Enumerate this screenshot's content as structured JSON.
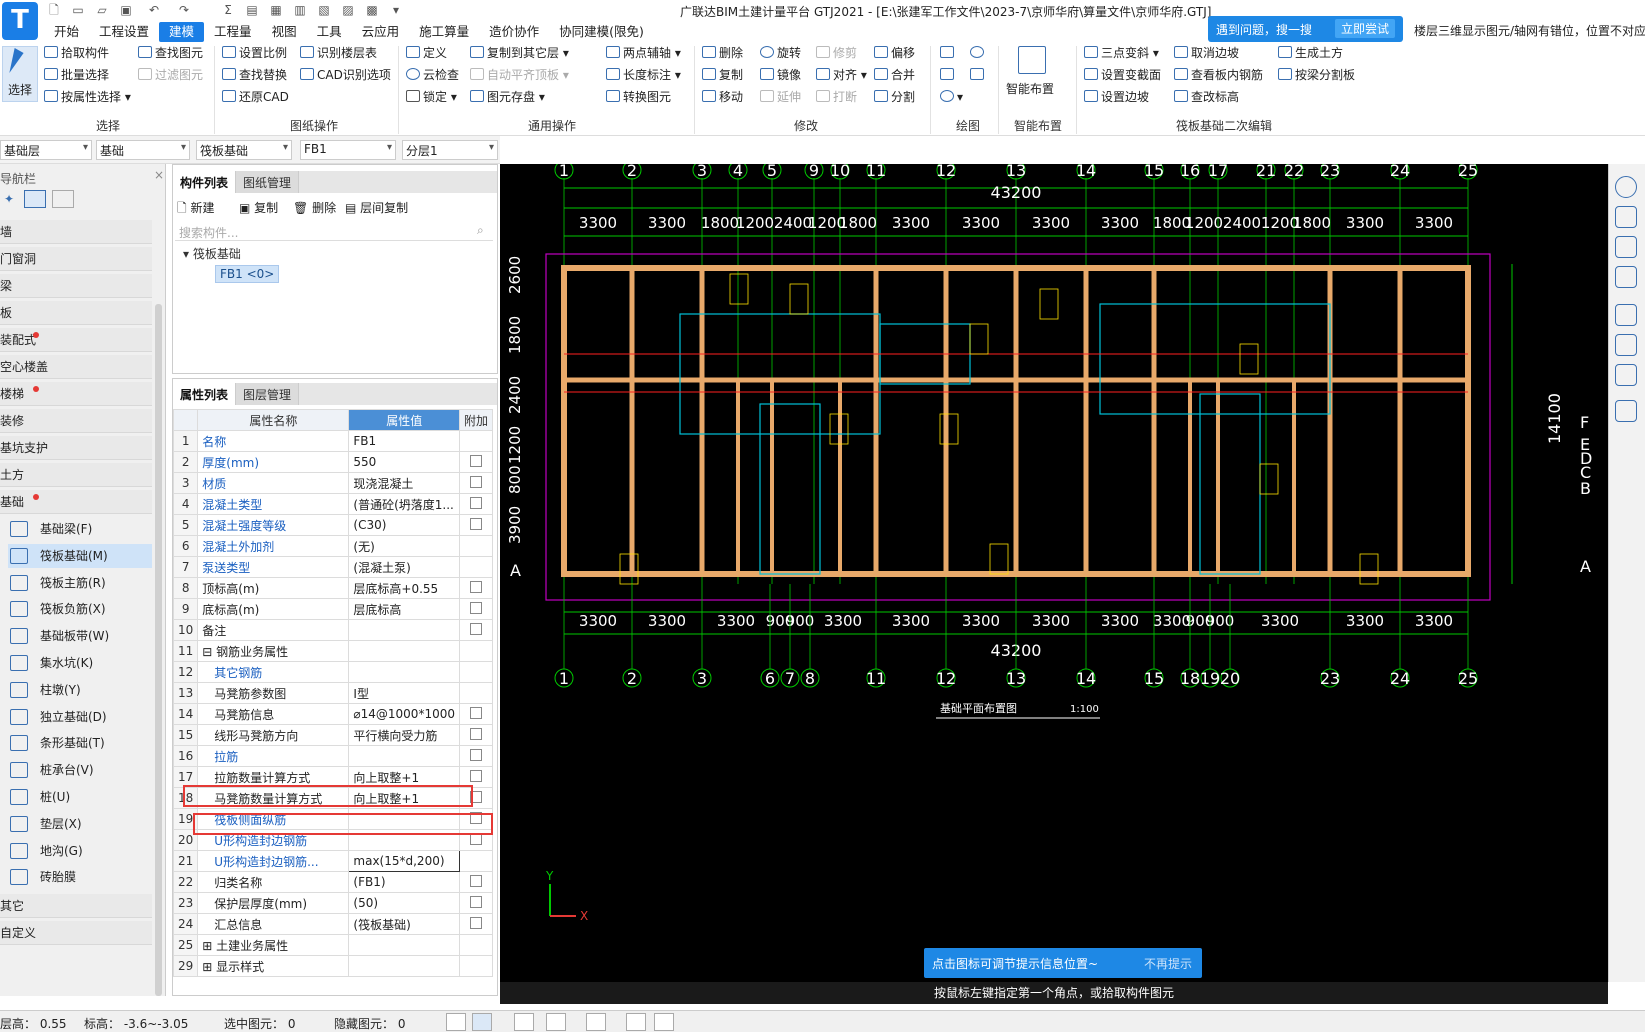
{
  "window": {
    "title": "广联达BIM土建计量平台 GTJ2021 - [E:\\张建军工作文件\\2023-7\\京师华府\\算量文件\\京师华府.GTJ]"
  },
  "menu": [
    "开始",
    "工程设置",
    "建模",
    "工程量",
    "视图",
    "工具",
    "云应用",
    "施工算量",
    "造价协作",
    "协同建模(限免)"
  ],
  "menu_active": "建模",
  "tip": {
    "text": "遇到问题，搜一搜",
    "button": "立即尝试"
  },
  "notice": "楼层三维显示图元/轴网有错位，位置不对应",
  "ribbon": {
    "select": {
      "big": "选择",
      "items": [
        "拾取构件",
        "批量选择",
        "按属性选择",
        "查找图元",
        "过滤图元"
      ],
      "label": "选择"
    },
    "drawing_ops": {
      "items": [
        "设置比例",
        "识别楼层表",
        "查找替换",
        "CAD识别选项",
        "还原CAD"
      ],
      "label": "图纸操作"
    },
    "common_ops": {
      "items": [
        "定义",
        "复制到其它层",
        "两点辅轴",
        "云检查",
        "自动平齐顶板",
        "长度标注",
        "锁定",
        "图元存盘",
        "转换图元"
      ],
      "label": "通用操作"
    },
    "modify": {
      "items": [
        "删除",
        "旋转",
        "修剪",
        "偏移",
        "复制",
        "镜像",
        "对齐",
        "合并",
        "移动",
        "延伸",
        "打断",
        "分割"
      ],
      "label": "修改"
    },
    "draw": {
      "label": "绘图"
    },
    "smart": {
      "big": "智能布置",
      "label": "智能布置"
    },
    "raft_edit": {
      "items": [
        "三点变斜",
        "取消边坡",
        "生成土方",
        "设置变截面",
        "查看板内钢筋",
        "按梁分割板",
        "设置边坡",
        "查改标高"
      ],
      "label": "筏板基础二次编辑"
    }
  },
  "combos": [
    "基础层",
    "基础",
    "筏板基础",
    "FB1",
    "分层1"
  ],
  "nav": {
    "title": "导航栏",
    "categories": [
      "墙",
      "门窗洞",
      "梁",
      "板",
      "装配式",
      "空心楼盖",
      "楼梯",
      "装修",
      "基坑支护",
      "土方",
      "基础"
    ],
    "categories_dot": [
      false,
      false,
      false,
      false,
      true,
      false,
      true,
      false,
      false,
      false,
      true
    ],
    "items": [
      "基础梁(F)",
      "筏板基础(M)",
      "筏板主筋(R)",
      "筏板负筋(X)",
      "基础板带(W)",
      "集水坑(K)",
      "柱墩(Y)",
      "独立基础(D)",
      "条形基础(T)",
      "桩承台(V)",
      "桩(U)",
      "垫层(X)",
      "地沟(G)",
      "砖胎膜"
    ],
    "selected": "筏板基础(M)",
    "bottom": [
      "其它",
      "自定义"
    ]
  },
  "component_list": {
    "tabs": [
      "构件列表",
      "图纸管理"
    ],
    "toolbar": [
      "新建",
      "复制",
      "删除",
      "层间复制"
    ],
    "search_placeholder": "搜索构件...",
    "tree_root": "筏板基础",
    "tree_leaf": "FB1 <0>"
  },
  "property_panel": {
    "tabs": [
      "属性列表",
      "图层管理"
    ],
    "headers": [
      "属性名称",
      "属性值",
      "附加"
    ],
    "rows": [
      {
        "no": "1",
        "name": "名称",
        "value": "FB1",
        "blue": true,
        "chk": false
      },
      {
        "no": "2",
        "name": "厚度(mm)",
        "value": "550",
        "blue": true,
        "chk": true
      },
      {
        "no": "3",
        "name": "材质",
        "value": "现浇混凝土",
        "blue": true,
        "chk": true
      },
      {
        "no": "4",
        "name": "混凝土类型",
        "value": "(普通砼(坍落度1...",
        "blue": true,
        "chk": true
      },
      {
        "no": "5",
        "name": "混凝土强度等级",
        "value": "(C30)",
        "blue": true,
        "chk": true
      },
      {
        "no": "6",
        "name": "混凝土外加剂",
        "value": "(无)",
        "blue": true,
        "chk": false
      },
      {
        "no": "7",
        "name": "泵送类型",
        "value": "(混凝土泵)",
        "blue": true,
        "chk": false
      },
      {
        "no": "8",
        "name": "顶标高(m)",
        "value": "层底标高+0.55",
        "blue": false,
        "chk": true
      },
      {
        "no": "9",
        "name": "底标高(m)",
        "value": "层底标高",
        "blue": false,
        "chk": true
      },
      {
        "no": "10",
        "name": "备注",
        "value": "",
        "blue": false,
        "chk": true
      },
      {
        "no": "11",
        "name": "⊟ 钢筋业务属性",
        "value": "",
        "blue": false,
        "chk": false
      },
      {
        "no": "12",
        "name": "　其它钢筋",
        "value": "",
        "blue": true,
        "chk": false
      },
      {
        "no": "13",
        "name": "　马凳筋参数图",
        "value": "I型",
        "blue": false,
        "chk": false
      },
      {
        "no": "14",
        "name": "　马凳筋信息",
        "value": "⌀14@1000*1000",
        "blue": false,
        "chk": true
      },
      {
        "no": "15",
        "name": "　线形马凳筋方向",
        "value": "平行横向受力筋",
        "blue": false,
        "chk": true
      },
      {
        "no": "16",
        "name": "　拉筋",
        "value": "",
        "blue": true,
        "chk": true
      },
      {
        "no": "17",
        "name": "　拉筋数量计算方式",
        "value": "向上取整+1",
        "blue": false,
        "chk": true
      },
      {
        "no": "18",
        "name": "　马凳筋数量计算方式",
        "value": "向上取整+1",
        "blue": false,
        "chk": true
      },
      {
        "no": "19",
        "name": "　筏板侧面纵筋",
        "value": "",
        "blue": true,
        "chk": true
      },
      {
        "no": "20",
        "name": "　U形构造封边钢筋",
        "value": "",
        "blue": true,
        "chk": true
      },
      {
        "no": "21",
        "name": "　U形构造封边钢筋...",
        "value": "max(15*d,200)",
        "blue": true,
        "chk": false
      },
      {
        "no": "22",
        "name": "　归类名称",
        "value": "(FB1)",
        "blue": false,
        "chk": true
      },
      {
        "no": "23",
        "name": "　保护层厚度(mm)",
        "value": "(50)",
        "blue": false,
        "chk": true
      },
      {
        "no": "24",
        "name": "　汇总信息",
        "value": "(筏板基础)",
        "blue": false,
        "chk": true
      },
      {
        "no": "25",
        "name": "⊞ 土建业务属性",
        "value": "",
        "blue": false,
        "chk": false
      },
      {
        "no": "29",
        "name": "⊞ 显示样式",
        "value": "",
        "blue": false,
        "chk": false
      }
    ]
  },
  "cad": {
    "top_axes": [
      "1",
      "2",
      "3",
      "4",
      "5",
      "9",
      "10",
      "11",
      "12",
      "13",
      "14",
      "15",
      "16",
      "17",
      "21",
      "22",
      "23",
      "24",
      "25"
    ],
    "bottom_axes": [
      "1",
      "2",
      "3",
      "6",
      "7",
      "8",
      "11",
      "12",
      "13",
      "14",
      "15",
      "18",
      "19",
      "20",
      "23",
      "24",
      "25"
    ],
    "top_dims": [
      "3300",
      "3300",
      "1800",
      "1200",
      "2400",
      "1200",
      "1800",
      "3300",
      "3300",
      "3300",
      "3300",
      "1800",
      "1200",
      "2400",
      "1200",
      "1800",
      "3300",
      "3300"
    ],
    "bottom_dims": [
      "3300",
      "3300",
      "3300",
      "900",
      "900",
      "3300",
      "3300",
      "3300",
      "3300",
      "3300",
      "3300",
      "900",
      "900",
      "3300",
      "3300",
      "3300"
    ],
    "total": "43200",
    "right_axes": [
      "F",
      "E",
      "D",
      "C",
      "B",
      "A"
    ],
    "left_dims": [
      "3900",
      "2600",
      "1800",
      "2400",
      "1200",
      "800"
    ],
    "right_total": "14100",
    "drawing_title": "基础平面布置图",
    "scale": "1:100",
    "colors": {
      "wall": "#e8a96a",
      "grid": "#00c800",
      "dim": "#ffffff",
      "border": "#c000c0",
      "blue": "#00c0d8",
      "yellow": "#ffe000",
      "red": "#ff2020"
    }
  },
  "hint": {
    "text": "点击图标可调节提示信息位置~",
    "dismiss": "不再提示"
  },
  "command_line": "按鼠标左键指定第一个角点，或拾取构件图元",
  "status": {
    "layer_height": "层高： 0.55",
    "elevation": "标高： -3.6~-3.05",
    "selected": "选中图元： 0",
    "hidden": "隐藏图元： 0"
  }
}
